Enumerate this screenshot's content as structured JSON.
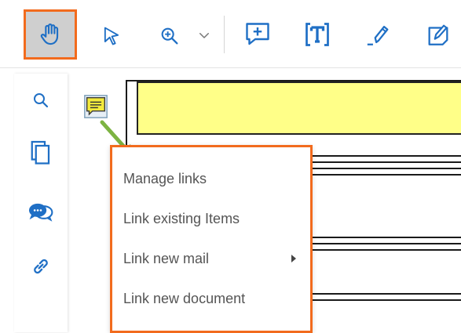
{
  "toolbar": {
    "tools": [
      {
        "id": "hand",
        "icon": "hand-icon",
        "active": true
      },
      {
        "id": "select",
        "icon": "pointer-icon"
      },
      {
        "id": "zoom",
        "icon": "zoom-in-icon"
      },
      {
        "id": "zoom-dropdown",
        "icon": "chevron-down-icon"
      },
      {
        "id": "add-comment",
        "icon": "comment-add-icon"
      },
      {
        "id": "text",
        "icon": "text-box-icon"
      },
      {
        "id": "highlight",
        "icon": "pen-icon"
      },
      {
        "id": "note",
        "icon": "note-edit-icon"
      }
    ]
  },
  "sidebar": {
    "items": [
      {
        "icon": "search-icon"
      },
      {
        "icon": "pages-icon"
      },
      {
        "icon": "comments-icon"
      },
      {
        "icon": "link-icon"
      }
    ]
  },
  "context_menu": {
    "items": [
      {
        "label": "Manage links"
      },
      {
        "label": "Link existing Items"
      },
      {
        "label": "Link new mail",
        "has_submenu": true
      },
      {
        "label": "Link new document"
      }
    ]
  },
  "colors": {
    "accent_orange": "#f26b1d",
    "icon_blue": "#1f6fc5",
    "highlight_yellow": "#ffff88",
    "arrow_green": "#7cb342"
  }
}
